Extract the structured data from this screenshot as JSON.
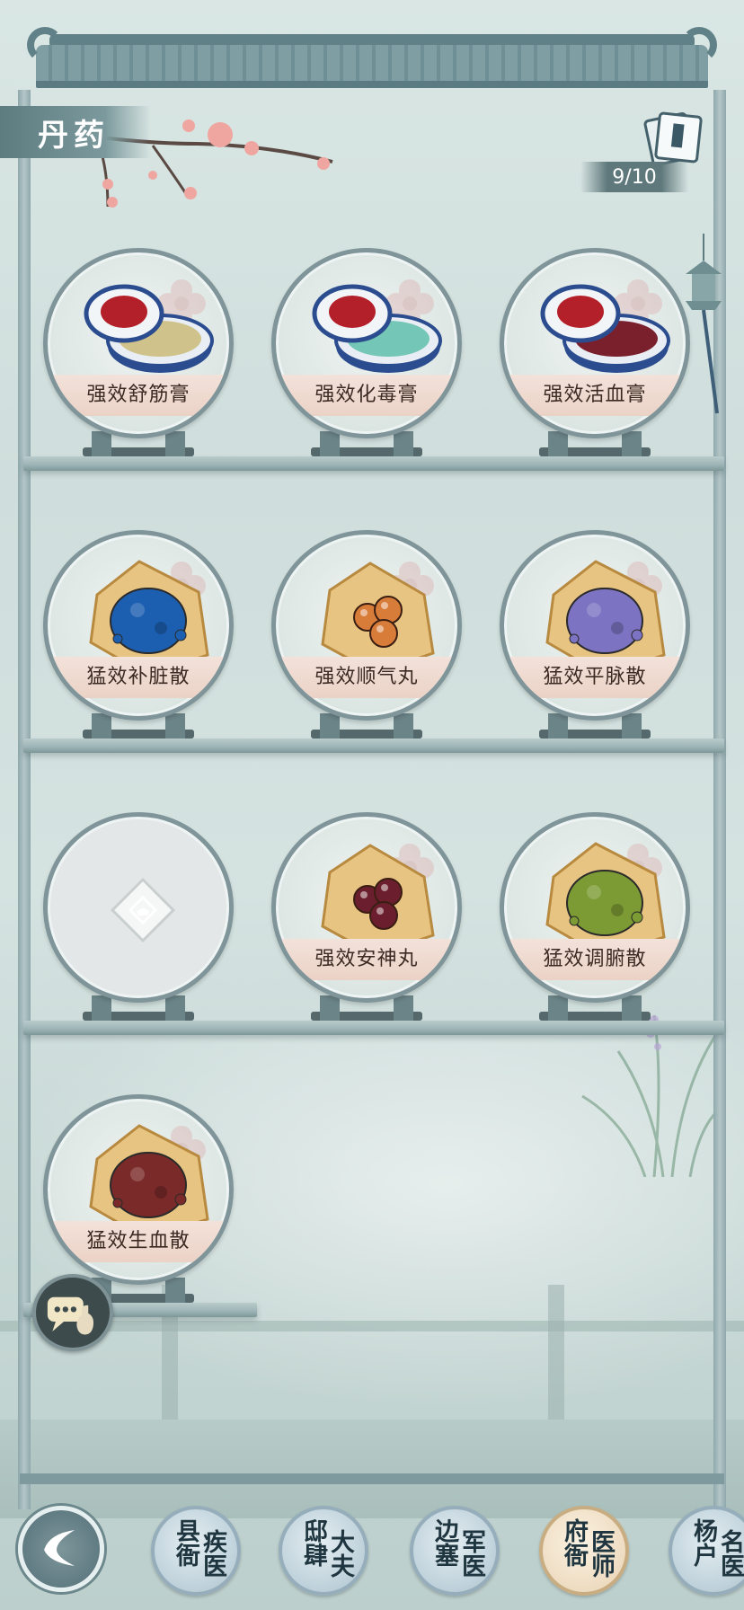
{
  "header": {
    "title": "丹药",
    "counter": "9/10"
  },
  "items": [
    {
      "name": "强效舒筋膏",
      "type": "jar",
      "color": "#cfc28a"
    },
    {
      "name": "强效化毒膏",
      "type": "jar",
      "color": "#74c7b6"
    },
    {
      "name": "强效活血膏",
      "type": "jar",
      "color": "#7a1f2c"
    },
    {
      "name": "猛效补脏散",
      "type": "powder",
      "color": "#1c5fb0"
    },
    {
      "name": "强效顺气丸",
      "type": "pills",
      "color": "#d87c3a"
    },
    {
      "name": "猛效平脉散",
      "type": "powder",
      "color": "#7c73c2"
    },
    {
      "name": "",
      "type": "locked",
      "color": "#ffffff"
    },
    {
      "name": "强效安神丸",
      "type": "pills",
      "color": "#6b1e2d"
    },
    {
      "name": "猛效调腑散",
      "type": "powder",
      "color": "#7d9b34"
    },
    {
      "name": "猛效生血散",
      "type": "powder",
      "color": "#7a2a28"
    }
  ],
  "nav": {
    "items": [
      {
        "l1": "县衙",
        "l2": "疾医"
      },
      {
        "l1": "邸肆",
        "l2": "大夫"
      },
      {
        "l1": "边塞",
        "l2": "军医"
      },
      {
        "l1": "府衙",
        "l2": "医师",
        "active": true
      },
      {
        "l1": "杨户",
        "l2": "名医"
      }
    ]
  }
}
